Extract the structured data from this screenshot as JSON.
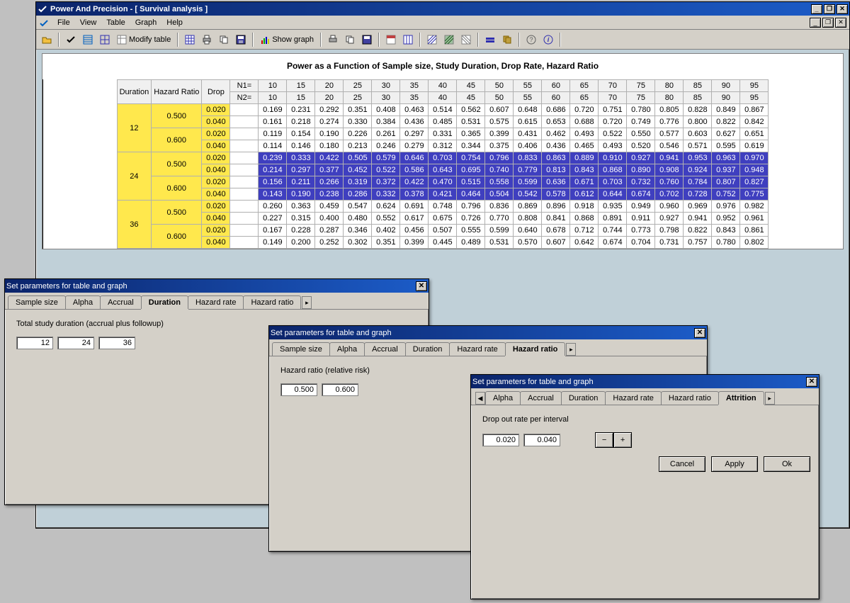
{
  "app": {
    "title": "Power And Precision - [ Survival analysis ]"
  },
  "menu": {
    "items": [
      "File",
      "View",
      "Table",
      "Graph",
      "Help"
    ]
  },
  "toolbar": {
    "modify_table": "Modify table",
    "show_graph": "Show graph"
  },
  "content": {
    "title": "Power as a Function of Sample size, Study Duration, Drop Rate, Hazard Ratio",
    "headers": {
      "duration": "Duration",
      "hazard_ratio": "Hazard Ratio",
      "drop": "Drop",
      "n1": "N1=",
      "n2": "N2="
    },
    "n_values": [
      10,
      15,
      20,
      25,
      30,
      35,
      40,
      45,
      50,
      55,
      60,
      65,
      70,
      75,
      80,
      85,
      90,
      95
    ],
    "groups": [
      {
        "duration": 12,
        "highlight": false,
        "hr_rows": [
          {
            "hr": "0.500",
            "drops": [
              {
                "drop": "0.020",
                "vals": [
                  0.169,
                  0.231,
                  0.292,
                  0.351,
                  0.408,
                  0.463,
                  0.514,
                  0.562,
                  0.607,
                  0.648,
                  0.686,
                  0.72,
                  0.751,
                  0.78,
                  0.805,
                  0.828,
                  0.849,
                  0.867
                ]
              },
              {
                "drop": "0.040",
                "vals": [
                  0.161,
                  0.218,
                  0.274,
                  0.33,
                  0.384,
                  0.436,
                  0.485,
                  0.531,
                  0.575,
                  0.615,
                  0.653,
                  0.688,
                  0.72,
                  0.749,
                  0.776,
                  0.8,
                  0.822,
                  0.842
                ]
              }
            ]
          },
          {
            "hr": "0.600",
            "drops": [
              {
                "drop": "0.020",
                "vals": [
                  0.119,
                  0.154,
                  0.19,
                  0.226,
                  0.261,
                  0.297,
                  0.331,
                  0.365,
                  0.399,
                  0.431,
                  0.462,
                  0.493,
                  0.522,
                  0.55,
                  0.577,
                  0.603,
                  0.627,
                  0.651
                ]
              },
              {
                "drop": "0.040",
                "vals": [
                  0.114,
                  0.146,
                  0.18,
                  0.213,
                  0.246,
                  0.279,
                  0.312,
                  0.344,
                  0.375,
                  0.406,
                  0.436,
                  0.465,
                  0.493,
                  0.52,
                  0.546,
                  0.571,
                  0.595,
                  0.619
                ]
              }
            ]
          }
        ]
      },
      {
        "duration": 24,
        "highlight": true,
        "hr_rows": [
          {
            "hr": "0.500",
            "drops": [
              {
                "drop": "0.020",
                "vals": [
                  0.239,
                  0.333,
                  0.422,
                  0.505,
                  0.579,
                  0.646,
                  0.703,
                  0.754,
                  0.796,
                  0.833,
                  0.863,
                  0.889,
                  0.91,
                  0.927,
                  0.941,
                  0.953,
                  0.963,
                  0.97
                ]
              },
              {
                "drop": "0.040",
                "vals": [
                  0.214,
                  0.297,
                  0.377,
                  0.452,
                  0.522,
                  0.586,
                  0.643,
                  0.695,
                  0.74,
                  0.779,
                  0.813,
                  0.843,
                  0.868,
                  0.89,
                  0.908,
                  0.924,
                  0.937,
                  0.948
                ]
              }
            ]
          },
          {
            "hr": "0.600",
            "drops": [
              {
                "drop": "0.020",
                "vals": [
                  0.156,
                  0.211,
                  0.266,
                  0.319,
                  0.372,
                  0.422,
                  0.47,
                  0.515,
                  0.558,
                  0.599,
                  0.636,
                  0.671,
                  0.703,
                  0.732,
                  0.76,
                  0.784,
                  0.807,
                  0.827
                ]
              },
              {
                "drop": "0.040",
                "vals": [
                  0.143,
                  0.19,
                  0.238,
                  0.286,
                  0.332,
                  0.378,
                  0.421,
                  0.464,
                  0.504,
                  0.542,
                  0.578,
                  0.612,
                  0.644,
                  0.674,
                  0.702,
                  0.728,
                  0.752,
                  0.775
                ]
              }
            ]
          }
        ]
      },
      {
        "duration": 36,
        "highlight": false,
        "hr_rows": [
          {
            "hr": "0.500",
            "drops": [
              {
                "drop": "0.020",
                "vals": [
                  0.26,
                  0.363,
                  0.459,
                  0.547,
                  0.624,
                  0.691,
                  0.748,
                  0.796,
                  0.836,
                  0.869,
                  0.896,
                  0.918,
                  0.935,
                  0.949,
                  0.96,
                  0.969,
                  0.976,
                  0.982
                ]
              },
              {
                "drop": "0.040",
                "vals": [
                  0.227,
                  0.315,
                  0.4,
                  0.48,
                  0.552,
                  0.617,
                  0.675,
                  0.726,
                  0.77,
                  0.808,
                  0.841,
                  0.868,
                  0.891,
                  0.911,
                  0.927,
                  0.941,
                  0.952,
                  0.961
                ]
              }
            ]
          },
          {
            "hr": "0.600",
            "drops": [
              {
                "drop": "0.020",
                "vals": [
                  0.167,
                  0.228,
                  0.287,
                  0.346,
                  0.402,
                  0.456,
                  0.507,
                  0.555,
                  0.599,
                  0.64,
                  0.678,
                  0.712,
                  0.744,
                  0.773,
                  0.798,
                  0.822,
                  0.843,
                  0.861
                ]
              },
              {
                "drop": "0.040",
                "vals": [
                  0.149,
                  0.2,
                  0.252,
                  0.302,
                  0.351,
                  0.399,
                  0.445,
                  0.489,
                  0.531,
                  0.57,
                  0.607,
                  0.642,
                  0.674,
                  0.704,
                  0.731,
                  0.757,
                  0.78,
                  0.802
                ]
              }
            ]
          }
        ]
      }
    ]
  },
  "dialogs": {
    "shared_title": "Set parameters for table and graph",
    "buttons": {
      "cancel": "Cancel",
      "apply": "Apply",
      "ok": "Ok"
    },
    "d1": {
      "tabs": [
        "Sample size",
        "Alpha",
        "Accrual",
        "Duration",
        "Hazard rate",
        "Hazard ratio"
      ],
      "active_tab": 3,
      "label": "Total study duration (accrual plus followup)",
      "values": [
        "12",
        "24",
        "36"
      ]
    },
    "d2": {
      "tabs": [
        "Sample size",
        "Alpha",
        "Accrual",
        "Duration",
        "Hazard rate",
        "Hazard ratio"
      ],
      "active_tab": 5,
      "label": "Hazard ratio (relative risk)",
      "values": [
        "0.500",
        "0.600"
      ]
    },
    "d3": {
      "tabs": [
        "Alpha",
        "Accrual",
        "Duration",
        "Hazard rate",
        "Hazard ratio",
        "Attrition"
      ],
      "active_tab": 5,
      "label": "Drop out rate per interval",
      "values": [
        "0.020",
        "0.040"
      ],
      "minus": "−",
      "plus": "+"
    }
  }
}
